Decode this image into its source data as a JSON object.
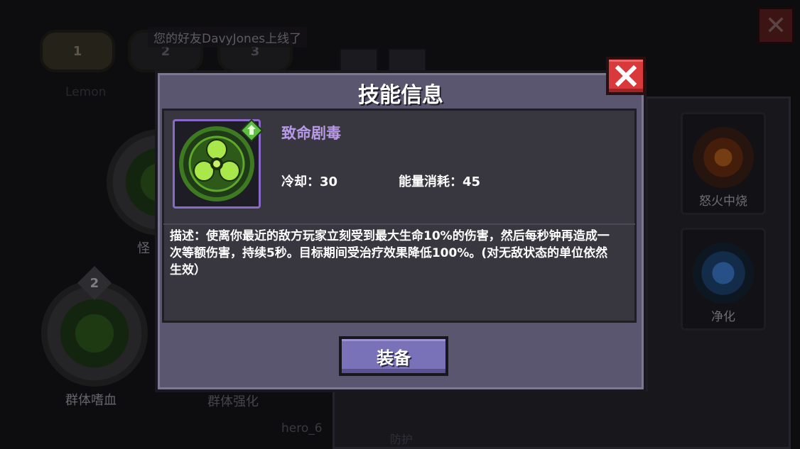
{
  "background": {
    "slots": [
      "1",
      "2",
      "3"
    ],
    "player_name": "Lemon",
    "toast": "您的好友DavyJones上线了",
    "hero_level": "2",
    "hero_labels": [
      "群体嗜血",
      "群体强化",
      "怪"
    ],
    "hero_id": "hero_6",
    "skills": [
      {
        "label": "怒火中烧",
        "icon": "fire-emblem-icon"
      },
      {
        "label": "净化",
        "icon": "fist-emblem-icon"
      }
    ],
    "bottom_skill_label": "防护"
  },
  "modal": {
    "title": "技能信息",
    "close_icon": "close-x-icon",
    "skill": {
      "name": "致命剧毒",
      "icon": "biohazard-skill-icon",
      "badge_icon": "green-rank-badge-icon",
      "cooldown_label": "冷却：30",
      "energy_label": "能量消耗：45",
      "description": "描述：使离你最近的敌方玩家立刻受到最大生命10%的伤害，然后每秒钟再造成一次等额伤害，持续5秒。目标期间受治疗效果降低100%。(对无敌状态的单位依然生效）"
    },
    "equip_label": "装备"
  },
  "colors": {
    "close_red": "#d9393b",
    "skill_name_purple": "#b89ae6",
    "equip_button": "#7a72b8",
    "poison_green": "#7fd23a"
  }
}
